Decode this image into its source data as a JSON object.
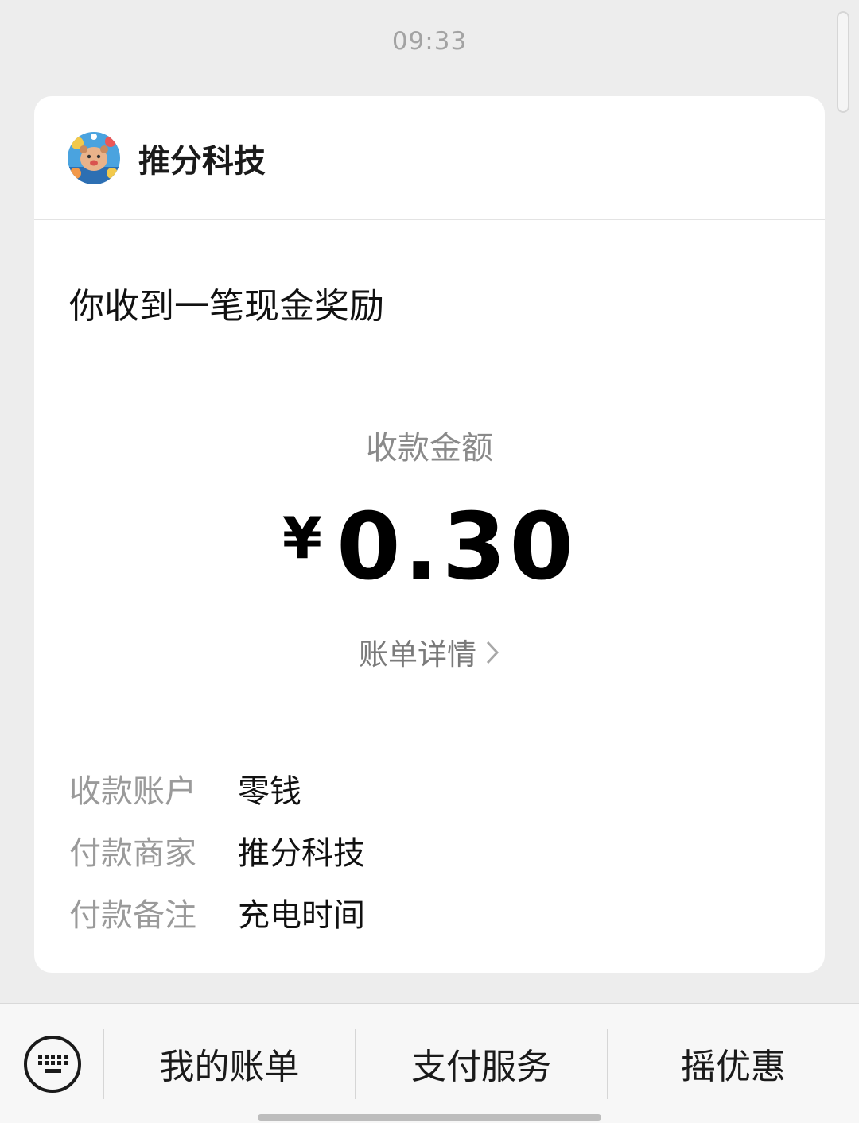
{
  "timestamp": "09:33",
  "card": {
    "merchant_name": "推分科技",
    "headline": "你收到一笔现金奖励",
    "amount_label": "收款金额",
    "currency": "¥",
    "amount": "0.30",
    "bill_link": "账单详情",
    "details": [
      {
        "key": "收款账户",
        "value": "零钱"
      },
      {
        "key": "付款商家",
        "value": "推分科技"
      },
      {
        "key": "付款备注",
        "value": "充电时间"
      }
    ]
  },
  "bottom_menu": {
    "keyboard_icon": "keyboard-icon",
    "items": [
      {
        "label": "我的账单"
      },
      {
        "label": "支付服务"
      },
      {
        "label": "摇优惠"
      }
    ]
  },
  "colors": {
    "background": "#ededed",
    "card": "#ffffff",
    "muted_text": "#9a9a9a"
  }
}
